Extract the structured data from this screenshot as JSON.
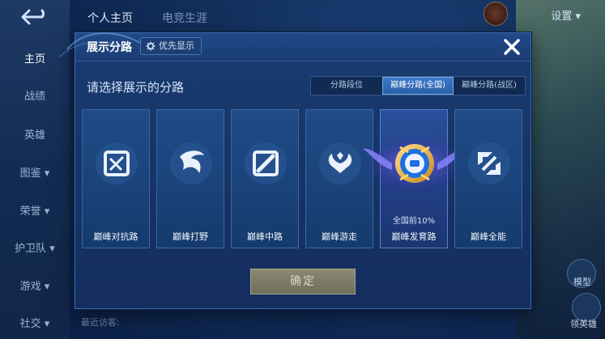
{
  "background": {
    "tabs": [
      "个人主页",
      "电竞生涯"
    ],
    "settings_label": "设置",
    "nav": [
      {
        "label": "主页",
        "active": true,
        "dot": false
      },
      {
        "label": "战绩",
        "active": false,
        "dot": false
      },
      {
        "label": "英雄",
        "active": false,
        "dot": false
      },
      {
        "label": "图鉴",
        "active": false,
        "dot": true
      },
      {
        "label": "荣誉",
        "active": false,
        "dot": true
      },
      {
        "label": "护卫队",
        "active": false,
        "dot": false
      },
      {
        "label": "游戏",
        "active": false,
        "dot": true
      },
      {
        "label": "社交",
        "active": false,
        "dot": true
      }
    ],
    "recent_label": "最近访客",
    "right_labels": [
      "模型",
      "领英雄"
    ]
  },
  "dialog": {
    "title": "展示分路",
    "priority_label": "优先显示",
    "subtitle": "请选择展示的分路",
    "segments": [
      {
        "label": "分路段位",
        "active": false
      },
      {
        "label": "巅峰分路(全国)",
        "active": true
      },
      {
        "label": "巅峰分路(战区)",
        "active": false
      }
    ],
    "cards": [
      {
        "label": "巅峰对抗路",
        "icon": "clash-lane-icon",
        "rank": ""
      },
      {
        "label": "巅峰打野",
        "icon": "jungle-icon",
        "rank": ""
      },
      {
        "label": "巅峰中路",
        "icon": "mid-lane-icon",
        "rank": ""
      },
      {
        "label": "巅峰游走",
        "icon": "roam-icon",
        "rank": ""
      },
      {
        "label": "巅峰发育路",
        "icon": "farm-lane-badge-icon",
        "rank": "全国前10%"
      },
      {
        "label": "巅峰全能",
        "icon": "all-round-icon",
        "rank": ""
      }
    ],
    "confirm_label": "确定"
  },
  "colors": {
    "panel": "#173568",
    "accent": "#3a78c8",
    "confirm": "#7c7c66"
  }
}
